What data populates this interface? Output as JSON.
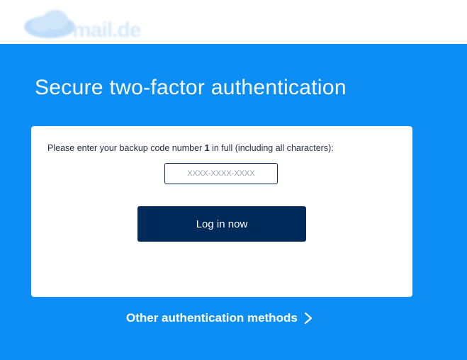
{
  "header": {
    "logo_text": "mail.de",
    "logo_icon": "cloud-logo-icon"
  },
  "main": {
    "title": "Secure two-factor authentication",
    "instruction": {
      "before": "Please enter your backup code number ",
      "number": "1",
      "after": " in full (including all characters):"
    },
    "code_input": {
      "placeholder": "XXXX-XXXX-XXXX",
      "value": ""
    },
    "login_button_label": "Log in now",
    "other_methods": {
      "label": "Other authentication methods",
      "icon": "chevron-right-icon"
    }
  },
  "colors": {
    "background": "#0c8ef5",
    "header_bg": "#ffffff",
    "button_bg": "#002a5a",
    "card_bg": "#ffffff"
  }
}
